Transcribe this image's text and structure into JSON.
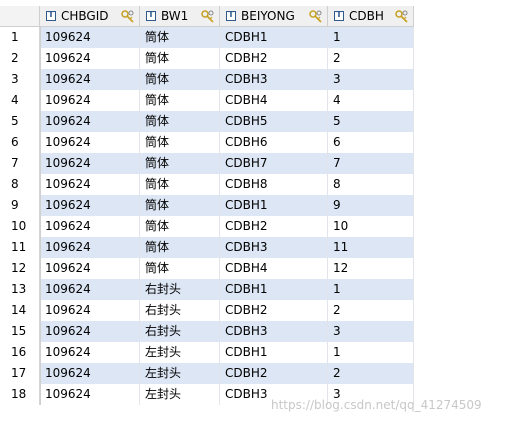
{
  "columns": [
    "CHBGID",
    "BW1",
    "BEIYONG",
    "CDBH"
  ],
  "rows": [
    {
      "num": "1",
      "cells": [
        "109624",
        "筒体",
        "CDBH1",
        "1"
      ]
    },
    {
      "num": "2",
      "cells": [
        "109624",
        "筒体",
        "CDBH2",
        "2"
      ]
    },
    {
      "num": "3",
      "cells": [
        "109624",
        "筒体",
        "CDBH3",
        "3"
      ]
    },
    {
      "num": "4",
      "cells": [
        "109624",
        "筒体",
        "CDBH4",
        "4"
      ]
    },
    {
      "num": "5",
      "cells": [
        "109624",
        "筒体",
        "CDBH5",
        "5"
      ]
    },
    {
      "num": "6",
      "cells": [
        "109624",
        "筒体",
        "CDBH6",
        "6"
      ]
    },
    {
      "num": "7",
      "cells": [
        "109624",
        "筒体",
        "CDBH7",
        "7"
      ]
    },
    {
      "num": "8",
      "cells": [
        "109624",
        "筒体",
        "CDBH8",
        "8"
      ]
    },
    {
      "num": "9",
      "cells": [
        "109624",
        "筒体",
        "CDBH1",
        "9"
      ]
    },
    {
      "num": "10",
      "cells": [
        "109624",
        "筒体",
        "CDBH2",
        "10"
      ]
    },
    {
      "num": "11",
      "cells": [
        "109624",
        "筒体",
        "CDBH3",
        "11"
      ]
    },
    {
      "num": "12",
      "cells": [
        "109624",
        "筒体",
        "CDBH4",
        "12"
      ]
    },
    {
      "num": "13",
      "cells": [
        "109624",
        "右封头",
        "CDBH1",
        "1"
      ]
    },
    {
      "num": "14",
      "cells": [
        "109624",
        "右封头",
        "CDBH2",
        "2"
      ]
    },
    {
      "num": "15",
      "cells": [
        "109624",
        "右封头",
        "CDBH3",
        "3"
      ]
    },
    {
      "num": "16",
      "cells": [
        "109624",
        "左封头",
        "CDBH1",
        "1"
      ]
    },
    {
      "num": "17",
      "cells": [
        "109624",
        "左封头",
        "CDBH2",
        "2"
      ]
    },
    {
      "num": "18",
      "cells": [
        "109624",
        "左封头",
        "CDBH3",
        "3"
      ]
    }
  ],
  "watermark": "https://blog.csdn.net/qq_41274509",
  "colors": {
    "row_stripe": "#dce6f4",
    "header_bg": "#f0f0f0",
    "column_type_icon": "#2e5a8e",
    "sort_icon": "#c8a020"
  },
  "icons": {
    "column_type": "text-type-icon",
    "column_sort": "sort-keys-icon"
  }
}
